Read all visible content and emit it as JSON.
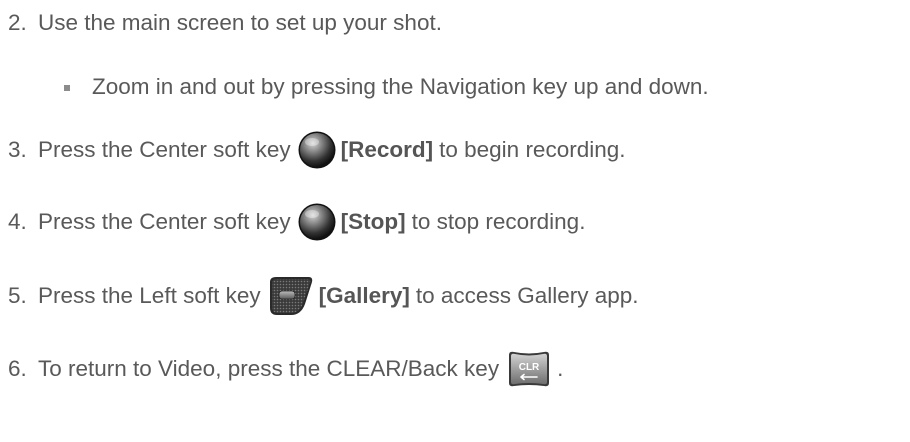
{
  "steps": [
    {
      "number": "2.",
      "text": "Use the main screen to set up your shot.",
      "sub_bullet": "Zoom in and out by pressing the Navigation key up and down."
    },
    {
      "number": "3.",
      "before": "Press the Center soft key",
      "icon": "center-soft-key-icon",
      "label": "[Record]",
      "after": "to begin recording."
    },
    {
      "number": "4.",
      "before": "Press the Center soft key",
      "icon": "center-soft-key-icon",
      "label": "[Stop]",
      "after": "to stop recording."
    },
    {
      "number": "5.",
      "before": "Press the Left soft key",
      "icon": "left-soft-key-icon",
      "label": "[Gallery]",
      "after": "to access Gallery app."
    },
    {
      "number": "6.",
      "before": "To return to Video, press the CLEAR/Back key",
      "icon": "clear-back-key-icon",
      "icon_text": "CLR",
      "after": "."
    }
  ]
}
